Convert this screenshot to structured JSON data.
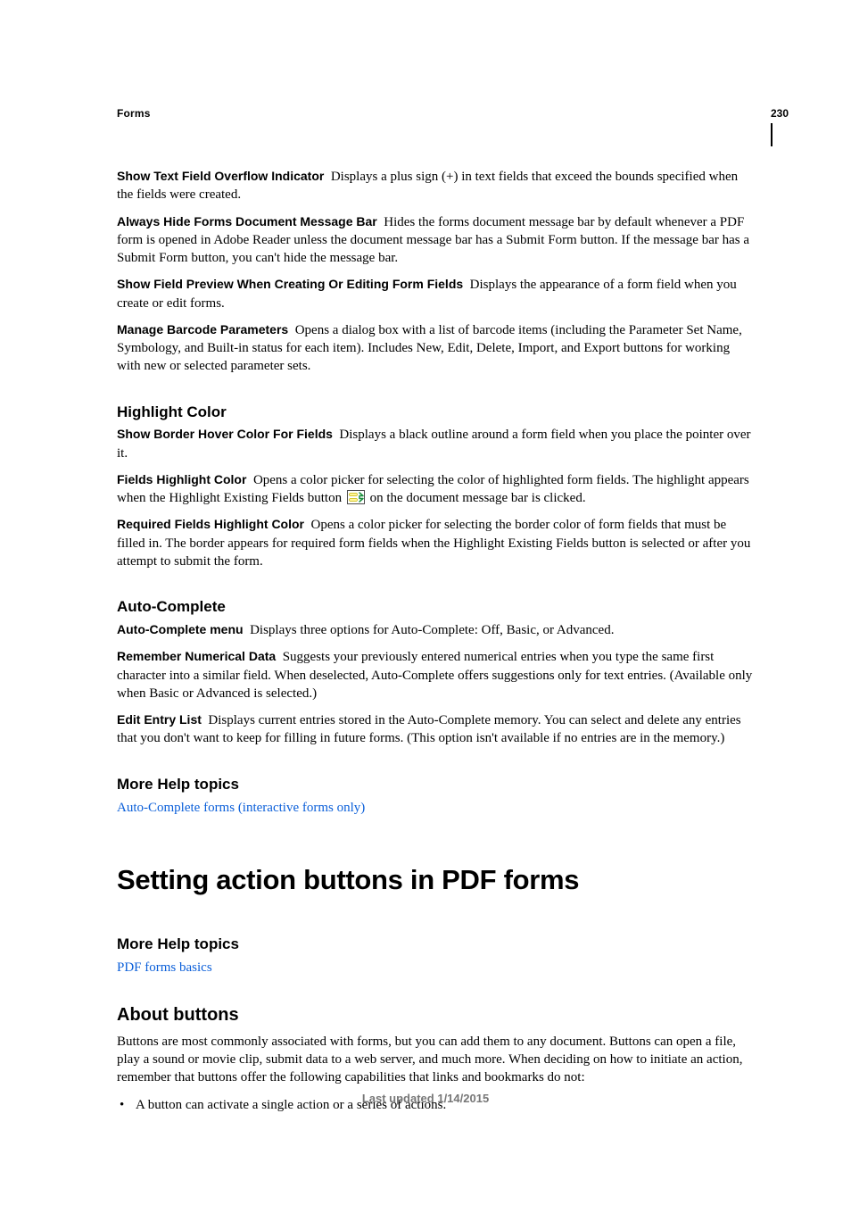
{
  "page_number": "230",
  "breadcrumb": "Forms",
  "defs": [
    {
      "term": "Show Text Field Overflow Indicator",
      "text": "Displays a plus sign (+) in text fields that exceed the bounds specified when the fields were created."
    },
    {
      "term": "Always Hide Forms Document Message Bar",
      "text": "Hides the forms document message bar by default whenever a PDF form is opened in Adobe Reader unless the document message bar has a Submit Form button. If the message bar has a Submit Form button, you can't hide the message bar."
    },
    {
      "term": "Show Field Preview When Creating Or Editing Form Fields",
      "text": "Displays the appearance of a form field when you create or edit forms."
    },
    {
      "term": "Manage Barcode Parameters",
      "text": "Opens a dialog box with a list of barcode items (including the Parameter Set Name, Symbology, and Built-in status for each item). Includes New, Edit, Delete, Import, and Export buttons for working with new or selected parameter sets."
    }
  ],
  "highlight_color": {
    "heading": "Highlight Color",
    "hover": {
      "term": "Show Border Hover Color For Fields",
      "text": "Displays a black outline around a form field when you place the pointer over it."
    },
    "fields": {
      "term": "Fields Highlight Color",
      "pre": "Opens a color picker for selecting the color of highlighted form fields. The highlight appears when the Highlight Existing Fields button",
      "post": "on the document message bar is clicked."
    },
    "required": {
      "term": "Required Fields Highlight Color",
      "text": "Opens a color picker for selecting the border color of form fields that must be filled in. The border appears for required form fields when the Highlight Existing Fields button is selected or after you attempt to submit the form."
    }
  },
  "auto_complete": {
    "heading": "Auto-Complete",
    "menu": {
      "term": "Auto-Complete menu",
      "text": "Displays three options for Auto-Complete: Off, Basic, or Advanced."
    },
    "remember": {
      "term": "Remember Numerical Data",
      "text": "Suggests your previously entered numerical entries when you type the same first character into a similar field. When deselected, Auto-Complete offers suggestions only for text entries. (Available only when Basic or Advanced is selected.)"
    },
    "edit": {
      "term": "Edit Entry List",
      "text": "Displays current entries stored in the Auto-Complete memory. You can select and delete any entries that you don't want to keep for filling in future forms. (This option isn't available if no entries are in the memory.)"
    }
  },
  "more_help_1": {
    "heading": "More Help topics",
    "link": "Auto-Complete forms (interactive forms only)"
  },
  "main_heading": "Setting action buttons in PDF forms",
  "more_help_2": {
    "heading": "More Help topics",
    "link": "PDF forms basics"
  },
  "about": {
    "heading": "About buttons",
    "para": "Buttons are most commonly associated with forms, but you can add them to any document. Buttons can open a file, play a sound or movie clip, submit data to a web server, and much more. When deciding on how to initiate an action, remember that buttons offer the following capabilities that links and bookmarks do not:",
    "bullet": "A button can activate a single action or a series of actions."
  },
  "footer": "Last updated 1/14/2015"
}
